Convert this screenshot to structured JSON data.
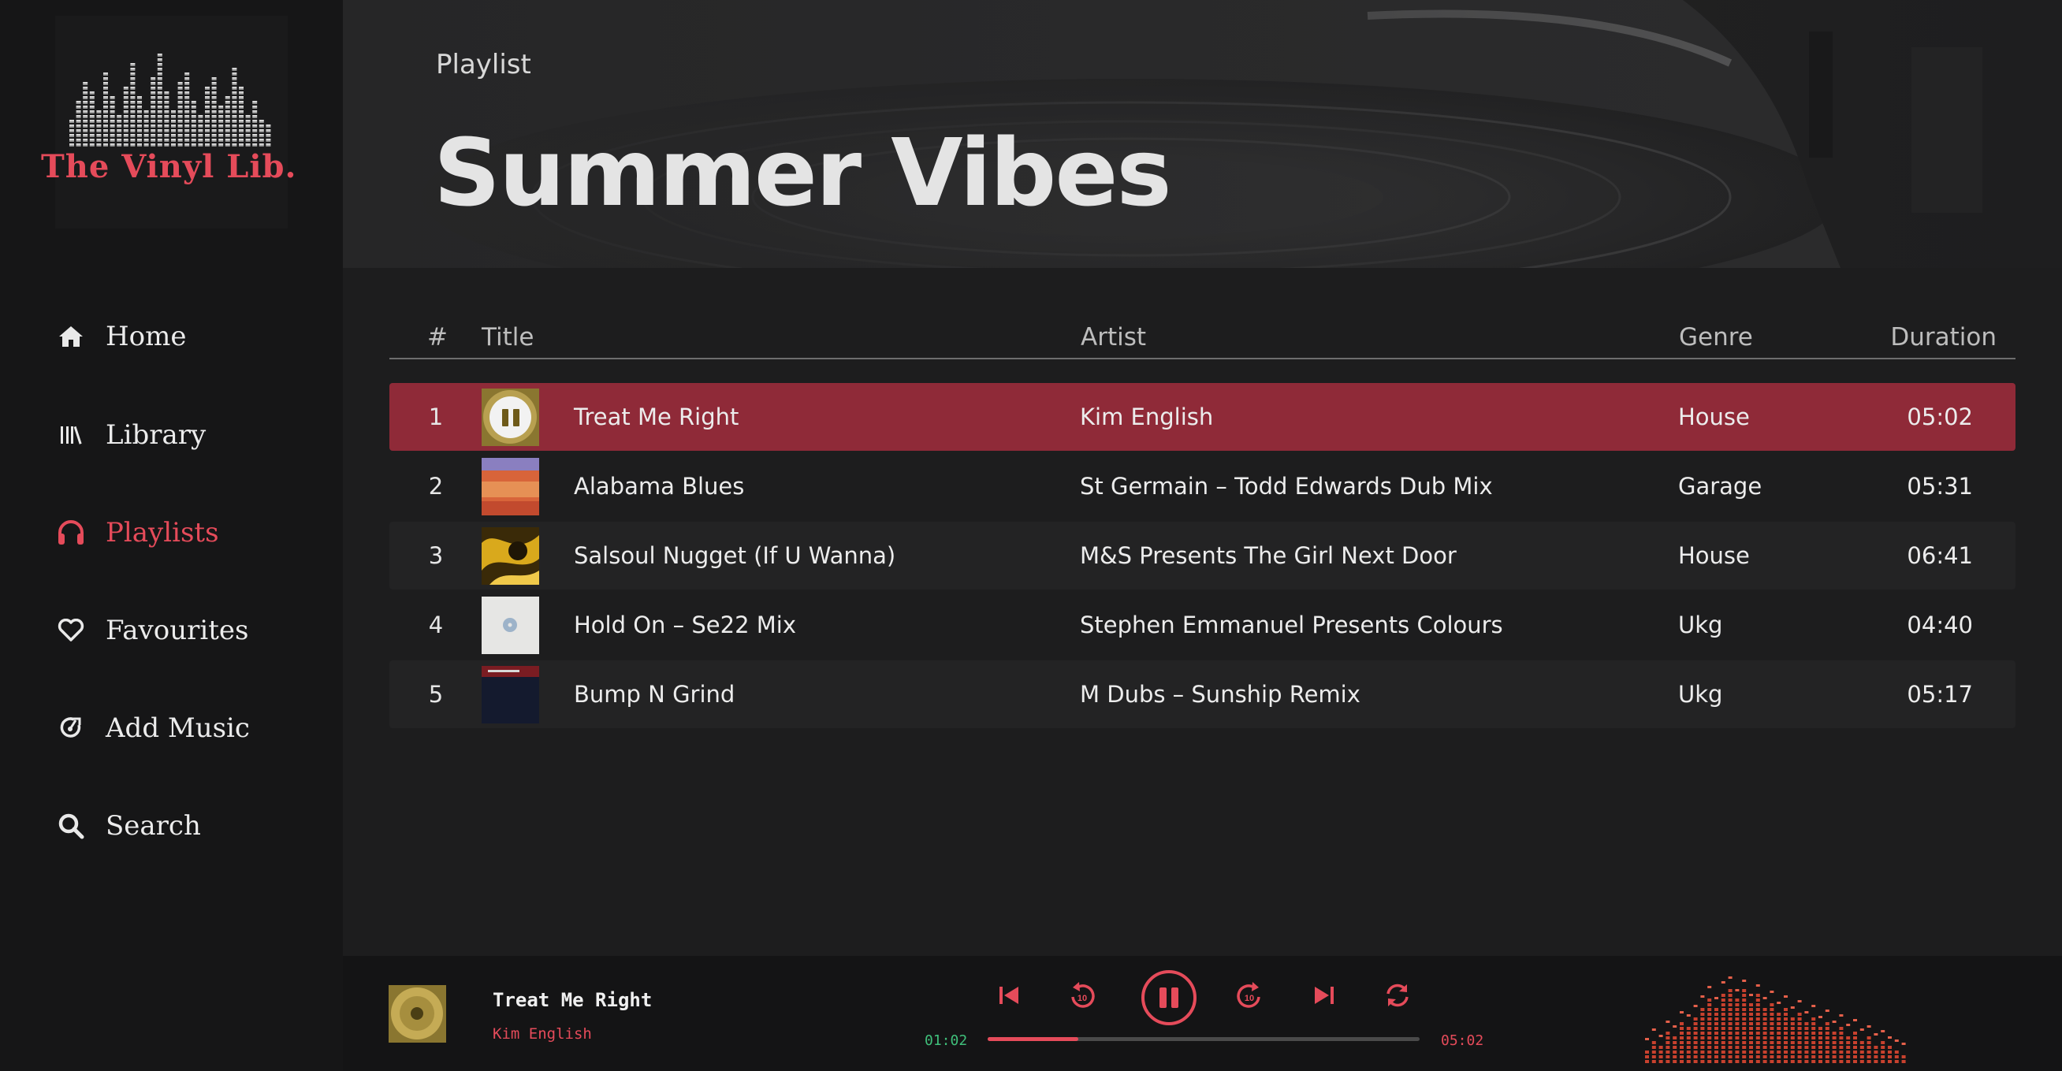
{
  "brand": {
    "name": "The Vinyl Lib."
  },
  "nav": [
    {
      "label": "Home",
      "icon": "home-icon",
      "active": false
    },
    {
      "label": "Library",
      "icon": "library-icon",
      "active": false
    },
    {
      "label": "Playlists",
      "icon": "headphones-icon",
      "active": true
    },
    {
      "label": "Favourites",
      "icon": "heart-icon",
      "active": false
    },
    {
      "label": "Add Music",
      "icon": "add-music-icon",
      "active": false
    },
    {
      "label": "Search",
      "icon": "search-icon",
      "active": false
    }
  ],
  "header": {
    "kicker": "Playlist",
    "title": "Summer Vibes"
  },
  "table": {
    "columns": {
      "num": "#",
      "title": "Title",
      "artist": "Artist",
      "genre": "Genre",
      "duration": "Duration"
    },
    "rows": [
      {
        "num": "1",
        "title": "Treat Me Right",
        "artist": "Kim English",
        "genre": "House",
        "duration": "05:02",
        "playing": true
      },
      {
        "num": "2",
        "title": "Alabama Blues",
        "artist": "St Germain – Todd Edwards Dub Mix",
        "genre": "Garage",
        "duration": "05:31",
        "playing": false
      },
      {
        "num": "3",
        "title": "Salsoul Nugget (If U Wanna)",
        "artist": "M&S Presents The Girl Next Door",
        "genre": "House",
        "duration": "06:41",
        "playing": false
      },
      {
        "num": "4",
        "title": "Hold On – Se22 Mix",
        "artist": "Stephen Emmanuel Presents Colours",
        "genre": "Ukg",
        "duration": "04:40",
        "playing": false
      },
      {
        "num": "5",
        "title": "Bump N Grind",
        "artist": "M Dubs – Sunship Remix",
        "genre": "Ukg",
        "duration": "05:17",
        "playing": false
      }
    ]
  },
  "player": {
    "title": "Treat Me Right",
    "artist": "Kim English",
    "current_time": "01:02",
    "total_time": "05:02",
    "progress": 0.21
  },
  "colors": {
    "accent": "#e54b5a",
    "active_row": "#8f2a38",
    "time_current": "#3fbf7a",
    "sidebar": "#161617",
    "main_bg": "#1d1d1e"
  }
}
